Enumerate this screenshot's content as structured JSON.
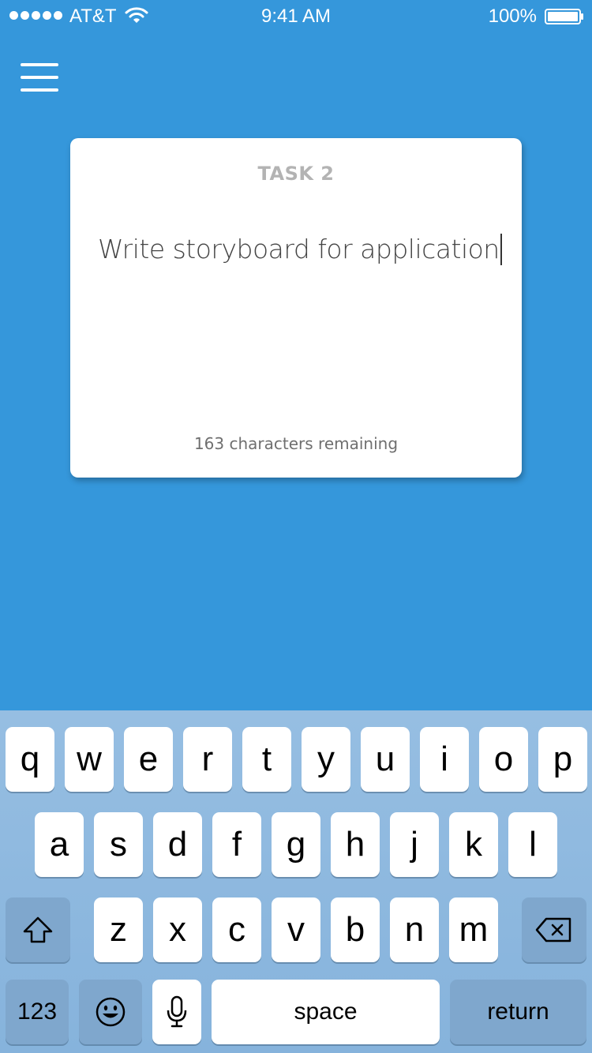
{
  "status_bar": {
    "carrier": "AT&T",
    "time": "9:41 AM",
    "battery": "100%",
    "signal_icon": "signal-dots-icon",
    "wifi_icon": "wifi-icon",
    "battery_icon": "battery-icon"
  },
  "header": {
    "menu_icon": "hamburger-menu-icon"
  },
  "task": {
    "title": "TASK 2",
    "text": "Write storyboard for application",
    "counter": "163 characters remaining"
  },
  "keyboard": {
    "row1": [
      "q",
      "w",
      "e",
      "r",
      "t",
      "y",
      "u",
      "i",
      "o",
      "p"
    ],
    "row2": [
      "a",
      "s",
      "d",
      "f",
      "g",
      "h",
      "j",
      "k",
      "l"
    ],
    "row3": [
      "z",
      "x",
      "c",
      "v",
      "b",
      "n",
      "m"
    ],
    "shift_icon": "shift-icon",
    "delete_icon": "backspace-icon",
    "numbers_label": "123",
    "emoji_icon": "emoji-icon",
    "mic_icon": "microphone-icon",
    "space_label": "space",
    "return_label": "return"
  },
  "colors": {
    "background": "#3597db",
    "card": "#ffffff",
    "title": "#b3b3b3",
    "keyboard_bg": "#8fb9e0",
    "function_key": "#7fa7cd"
  }
}
